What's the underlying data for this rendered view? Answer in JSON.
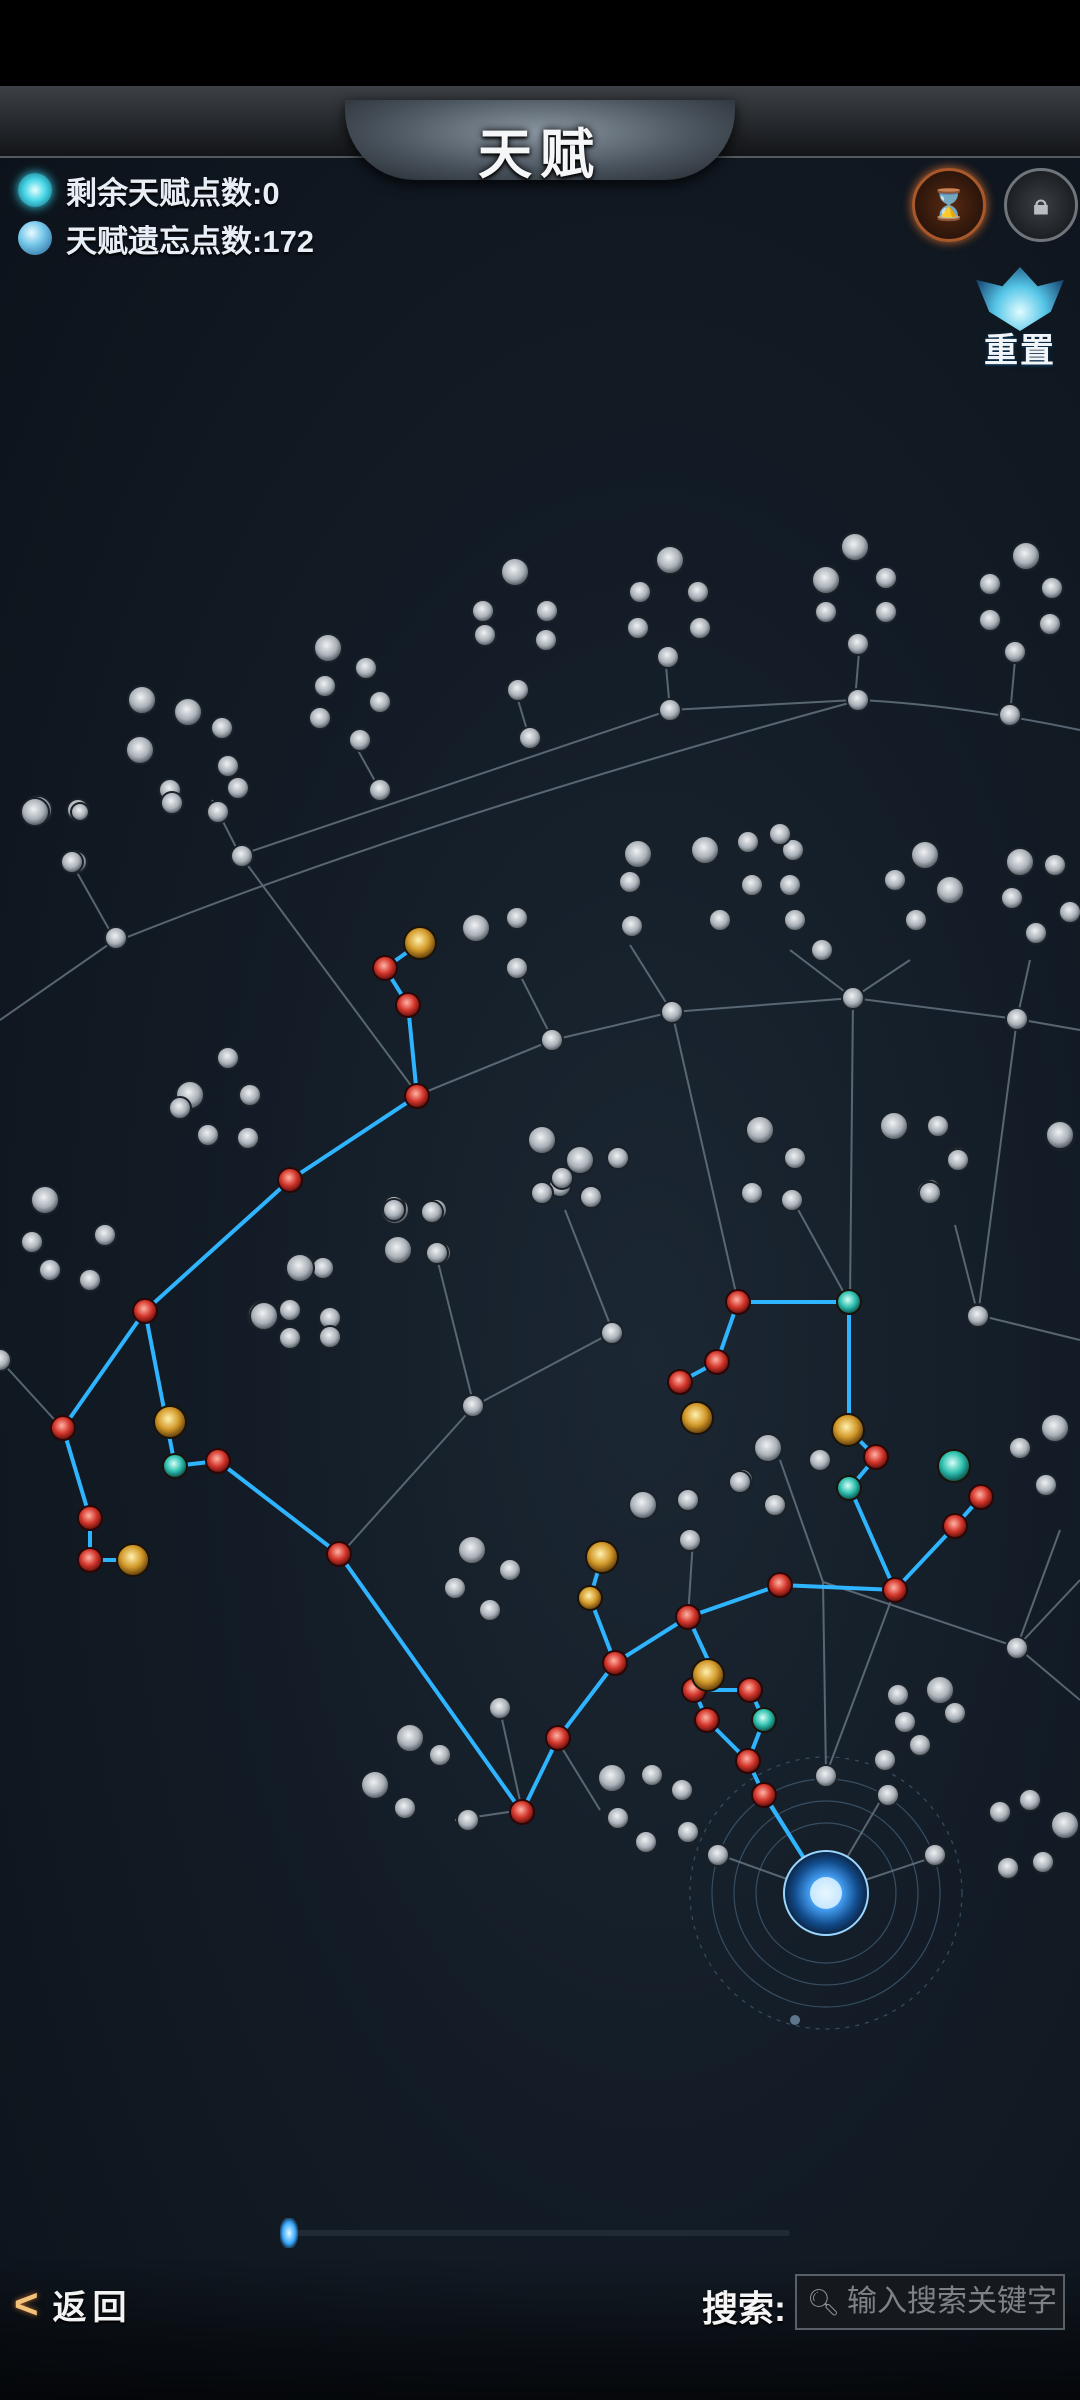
{
  "header": {
    "title": "天赋"
  },
  "stats": {
    "remaining_points": "剩余天赋点数:0",
    "forget_points": "天赋遗忘点数:172"
  },
  "buttons": {
    "hourglass_icon": "hourglass-icon",
    "lock_icon": "lock-icon",
    "reset_label": "重置",
    "back_label": "返回"
  },
  "search": {
    "label": "搜索:",
    "placeholder": "输入搜索关键字"
  },
  "colors": {
    "active_link": "#2fb4ff",
    "inactive_link": "#7c8a96",
    "active_node": "#d63a2f",
    "inactive_node": "#bfc5ca",
    "core_node": "#3a9dff"
  },
  "tree": {
    "core_node": "talent-core",
    "active_nodes": 34,
    "node_types": [
      "active",
      "inactive",
      "gold",
      "teal",
      "cluster"
    ]
  }
}
